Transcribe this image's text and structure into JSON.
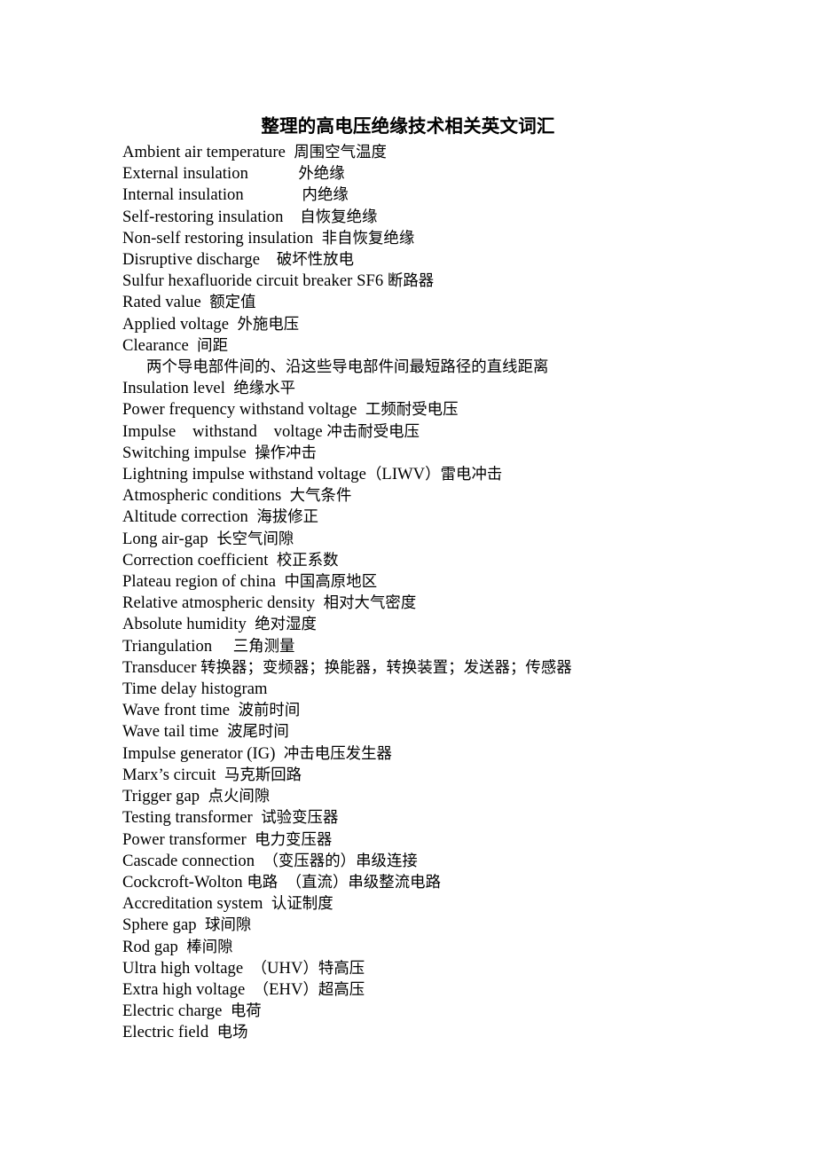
{
  "document": {
    "title": "整理的高电压绝缘技术相关英文词汇",
    "entries": [
      {
        "text": "Ambient air temperature  周围空气温度",
        "indented": false
      },
      {
        "text": "External insulation            外绝缘",
        "indented": false
      },
      {
        "text": "Internal insulation              内绝缘",
        "indented": false
      },
      {
        "text": "Self-restoring insulation    自恢复绝缘",
        "indented": false
      },
      {
        "text": "Non-self restoring insulation  非自恢复绝缘",
        "indented": false
      },
      {
        "text": "Disruptive discharge    破坏性放电",
        "indented": false
      },
      {
        "text": "Sulfur hexafluoride circuit breaker SF6 断路器",
        "indented": false
      },
      {
        "text": "Rated value  额定值",
        "indented": false
      },
      {
        "text": "Applied voltage  外施电压",
        "indented": false
      },
      {
        "text": "Clearance  间距",
        "indented": false
      },
      {
        "text": "两个导电部件间的、沿这些导电部件间最短路径的直线距离",
        "indented": true
      },
      {
        "text": "Insulation level  绝缘水平",
        "indented": false
      },
      {
        "text": "Power frequency withstand voltage  工频耐受电压",
        "indented": false
      },
      {
        "text": "Impulse    withstand    voltage 冲击耐受电压",
        "indented": false
      },
      {
        "text": "Switching impulse  操作冲击",
        "indented": false
      },
      {
        "text": "Lightning impulse withstand voltage（LIWV）雷电冲击",
        "indented": false
      },
      {
        "text": "Atmospheric conditions  大气条件",
        "indented": false
      },
      {
        "text": "Altitude correction  海拔修正",
        "indented": false
      },
      {
        "text": "Long air-gap  长空气间隙",
        "indented": false
      },
      {
        "text": "Correction coefficient  校正系数",
        "indented": false
      },
      {
        "text": "Plateau region of china  中国高原地区",
        "indented": false
      },
      {
        "text": "Relative atmospheric density  相对大气密度",
        "indented": false
      },
      {
        "text": "Absolute humidity  绝对湿度",
        "indented": false
      },
      {
        "text": "Triangulation     三角测量",
        "indented": false
      },
      {
        "text": "Transducer 转换器；变频器；换能器，转换装置；发送器；传感器",
        "indented": false
      },
      {
        "text": "Time delay histogram",
        "indented": false
      },
      {
        "text": "Wave front time  波前时间",
        "indented": false
      },
      {
        "text": "Wave tail time  波尾时间",
        "indented": false
      },
      {
        "text": "Impulse generator (IG)  冲击电压发生器",
        "indented": false
      },
      {
        "text": "Marx’s circuit  马克斯回路",
        "indented": false
      },
      {
        "text": "Trigger gap  点火间隙",
        "indented": false
      },
      {
        "text": "Testing transformer  试验变压器",
        "indented": false
      },
      {
        "text": "Power transformer  电力变压器",
        "indented": false
      },
      {
        "text": "Cascade connection  （变压器的）串级连接",
        "indented": false
      },
      {
        "text": "Cockcroft-Wolton 电路  （直流）串级整流电路",
        "indented": false
      },
      {
        "text": "Accreditation system  认证制度",
        "indented": false
      },
      {
        "text": "Sphere gap  球间隙",
        "indented": false
      },
      {
        "text": "Rod gap  棒间隙",
        "indented": false
      },
      {
        "text": "Ultra high voltage  （UHV）特高压",
        "indented": false
      },
      {
        "text": "Extra high voltage  （EHV）超高压",
        "indented": false
      },
      {
        "text": "Electric charge  电荷",
        "indented": false
      },
      {
        "text": "Electric field  电场",
        "indented": false
      }
    ]
  }
}
